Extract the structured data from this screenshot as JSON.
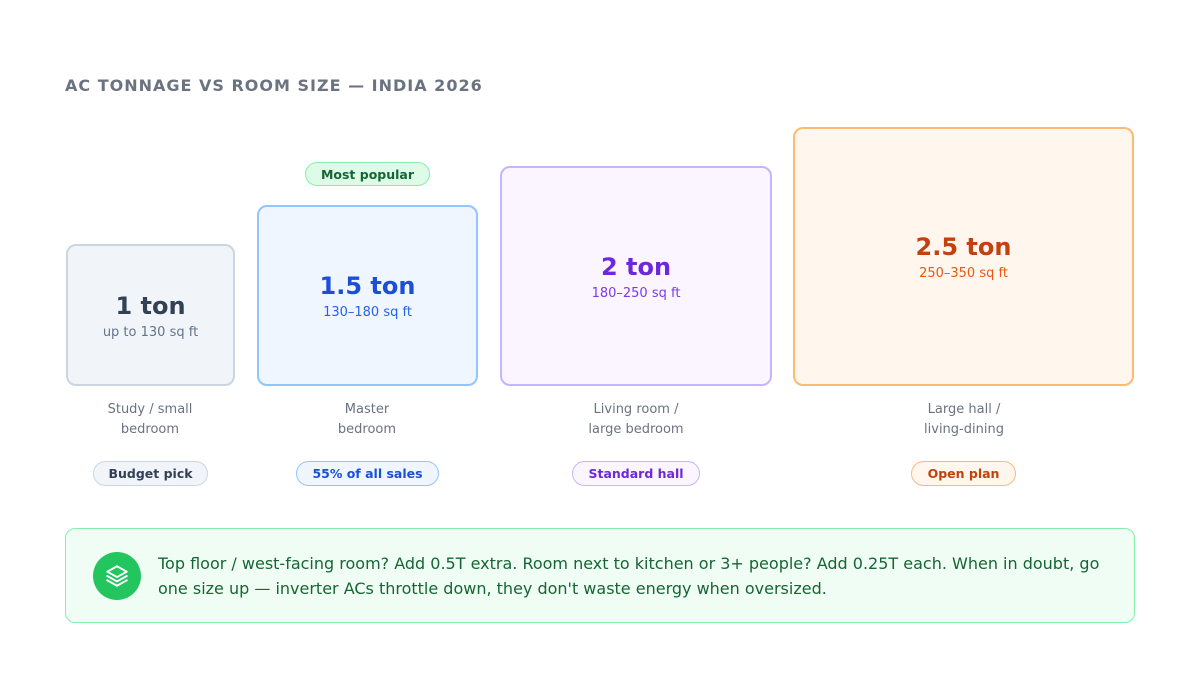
{
  "title": "AC TONNAGE VS ROOM SIZE — INDIA 2026",
  "cards": [
    {
      "ton": "1 ton",
      "range": "up to 130 sq ft",
      "room_line1": "Study / small",
      "room_line2": "bedroom",
      "tag": "Budget pick",
      "badge": "",
      "colors": {
        "border": "#cbd5e1",
        "bg": "#f1f5f9",
        "ton": "#334155",
        "range": "#64748b",
        "tag_text": "#334155",
        "tag_border": "#cbd5e1",
        "tag_bg": "#f1f5f9"
      }
    },
    {
      "ton": "1.5 ton",
      "range": "130–180 sq ft",
      "room_line1": "Master",
      "room_line2": "bedroom",
      "tag": "55% of all sales",
      "badge": "Most popular",
      "colors": {
        "border": "#93c5fd",
        "bg": "#eff6ff",
        "ton": "#1d4ed8",
        "range": "#2563eb",
        "tag_text": "#1d4ed8",
        "tag_border": "#93c5fd",
        "tag_bg": "#eff6ff",
        "badge_text": "#166534",
        "badge_border": "#86efac",
        "badge_bg": "#dcfce7"
      }
    },
    {
      "ton": "2 ton",
      "range": "180–250 sq ft",
      "room_line1": "Living room /",
      "room_line2": "large bedroom",
      "tag": "Standard hall",
      "badge": "",
      "colors": {
        "border": "#c4b5fd",
        "bg": "#faf5ff",
        "ton": "#6d28d9",
        "range": "#7c3aed",
        "tag_text": "#6d28d9",
        "tag_border": "#c4b5fd",
        "tag_bg": "#faf5ff"
      }
    },
    {
      "ton": "2.5 ton",
      "range": "250–350 sq ft",
      "room_line1": "Large hall /",
      "room_line2": "living-dining",
      "tag": "Open plan",
      "badge": "",
      "colors": {
        "border": "#fdba74",
        "bg": "#fff7ed",
        "ton": "#c2410c",
        "range": "#ea580c",
        "tag_text": "#c2410c",
        "tag_border": "#fdba74",
        "tag_bg": "#fff7ed"
      }
    }
  ],
  "tip": {
    "icon": "layers-icon",
    "text": "Top floor / west-facing room? Add 0.5T extra. Room next to kitchen or 3+ people? Add 0.25T each. When in doubt, go one size up — inverter ACs throttle down, they don't waste energy when oversized."
  }
}
